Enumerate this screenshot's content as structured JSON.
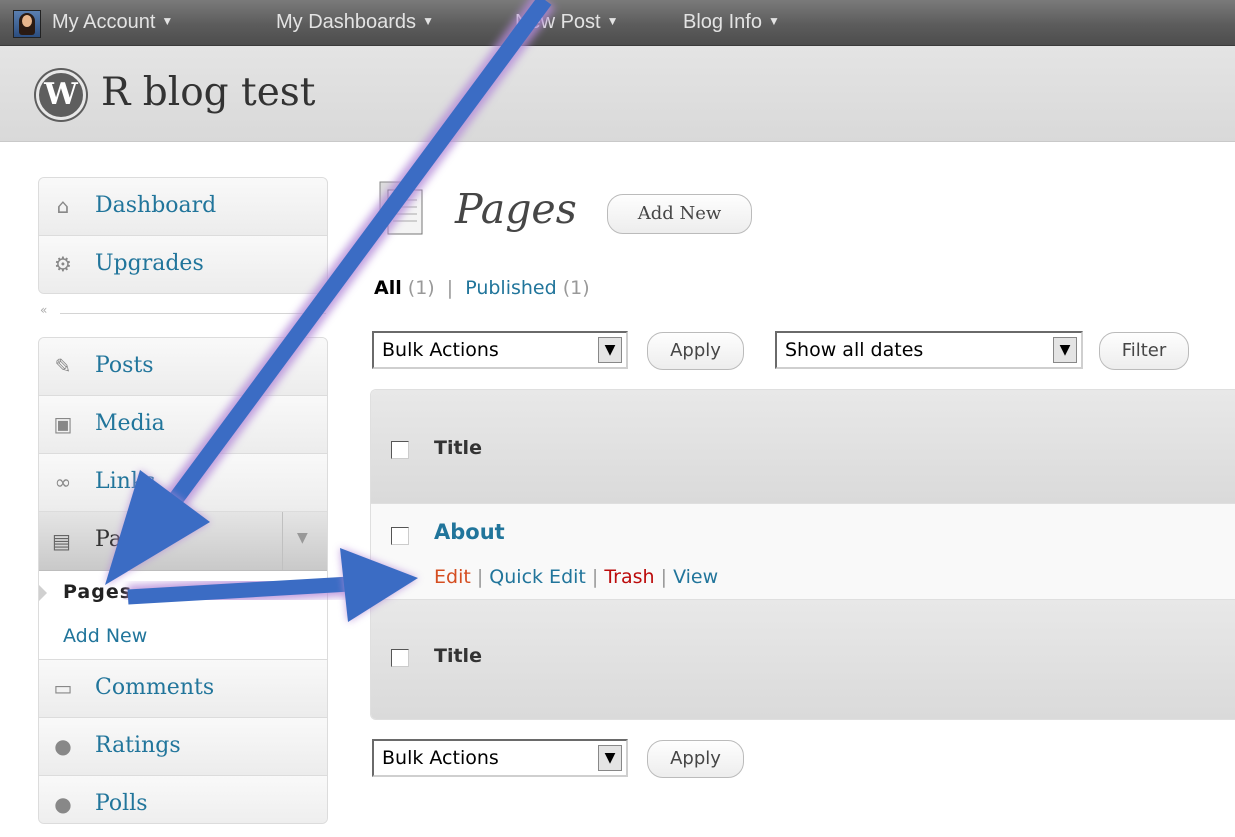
{
  "adminbar": {
    "items": [
      {
        "label": "My Account"
      },
      {
        "label": "My Dashboards"
      },
      {
        "label": "New Post"
      },
      {
        "label": "Blog Info"
      }
    ]
  },
  "header": {
    "site_title": "R blog test"
  },
  "sidebar": {
    "top": [
      {
        "label": "Dashboard",
        "icon": "house-icon"
      },
      {
        "label": "Upgrades",
        "icon": "gear-icon"
      }
    ],
    "collapse_glyph": "«",
    "main": [
      {
        "label": "Posts",
        "icon": "pin-icon"
      },
      {
        "label": "Media",
        "icon": "media-icon"
      },
      {
        "label": "Links",
        "icon": "chain-link-icon"
      }
    ],
    "pages_menu": {
      "label": "Pages",
      "submenu": [
        {
          "label": "Pages"
        },
        {
          "label": "Add New"
        }
      ]
    },
    "bottom": [
      {
        "label": "Comments",
        "icon": "speech-bubble-icon"
      },
      {
        "label": "Ratings",
        "icon": "circle-icon"
      },
      {
        "label": "Polls",
        "icon": "circle-icon"
      }
    ]
  },
  "main": {
    "title": "Pages",
    "add_new_label": "Add New",
    "filters": {
      "all_label": "All",
      "all_count": "(1)",
      "separator": "|",
      "published_label": "Published",
      "published_count": "(1)"
    },
    "top_controls": {
      "bulk_actions": "Bulk Actions",
      "apply_label": "Apply",
      "dates": "Show all dates",
      "filter_label": "Filter"
    },
    "table": {
      "header_label": "Title",
      "footer_label": "Title",
      "rows": [
        {
          "title": "About",
          "actions": {
            "edit": "Edit",
            "quick_edit": "Quick Edit",
            "trash": "Trash",
            "view": "View",
            "sep": "|"
          }
        }
      ]
    },
    "bottom_controls": {
      "bulk_actions": "Bulk Actions",
      "apply_label": "Apply"
    }
  },
  "colors": {
    "link": "#21759b",
    "edit": "#d54e21",
    "trash": "#bc0b0b",
    "arrow": "#3b6cc4",
    "arrow_glow": "#b48ad8"
  }
}
